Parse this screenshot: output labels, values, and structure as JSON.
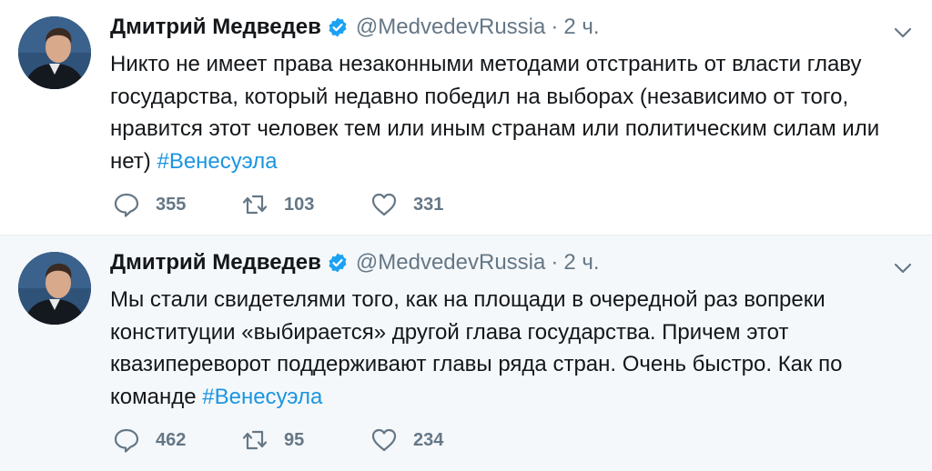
{
  "tweets": [
    {
      "author_name": "Дмитрий Медведев",
      "handle": "@MedvedevRussia",
      "separator": "·",
      "time": "2 ч.",
      "lines": [
        "Никто не имеет права незаконными методами отстранить от власти главу",
        "государства, который недавно победил на выборах (независимо от того,",
        "нравится этот человек тем или иным странам или политическим силам или"
      ],
      "last_line_prefix": "нет)",
      "hashtag": "#Венесуэла",
      "replies": "355",
      "retweets": "103",
      "likes": "331"
    },
    {
      "author_name": "Дмитрий Медведев",
      "handle": "@MedvedevRussia",
      "separator": "·",
      "time": "2 ч.",
      "lines": [
        "Мы стали свидетелями того, как на площади в очередной раз вопреки",
        "конституции «выбирается» другой глава государства. Причем этот",
        "квазипереворот поддерживают главы ряда стран. Очень быстро. Как по"
      ],
      "last_line_prefix": "команде",
      "hashtag": "#Венесуэла",
      "replies": "462",
      "retweets": "95",
      "likes": "234"
    }
  ],
  "icons": {
    "verified": "verified-badge-icon",
    "menu": "chevron-down-icon",
    "reply": "reply-icon",
    "retweet": "retweet-icon",
    "like": "heart-icon"
  },
  "colors": {
    "text": "#14171a",
    "secondary": "#657786",
    "link": "#1b95e0",
    "verified": "#1da1f2",
    "highlight_bg": "#f5f8fa"
  }
}
